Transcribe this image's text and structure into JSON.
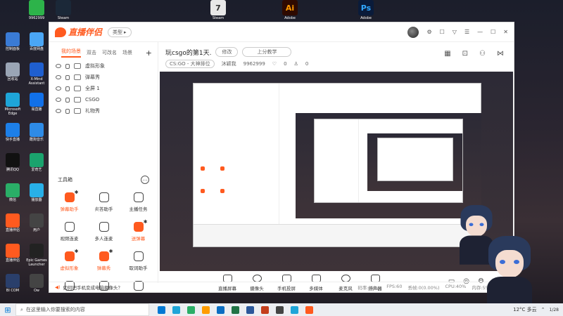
{
  "desktop": {
    "top_icons": [
      {
        "label": "9962999",
        "color": "#2db34a"
      },
      {
        "label": "Steam",
        "color": "#1b2838"
      },
      {
        "label": "Steam",
        "color": "#e8e8e8"
      },
      {
        "label": "Adobe",
        "color": "#2e0a00"
      },
      {
        "label": "Adobe",
        "color": "#0a1b3a"
      }
    ],
    "top_glyphs": [
      "",
      "",
      "7",
      "Ai",
      "Ps"
    ],
    "left_icons": [
      {
        "label": "控制面板",
        "color": "#3a7bd5"
      },
      {
        "label": "百度网盘",
        "color": "#4aa6f5"
      },
      {
        "label": "回收站",
        "color": "#9aa5b5"
      },
      {
        "label": "X-Mind Assistant",
        "color": "#1f5fcf"
      },
      {
        "label": "Microsoft Edge",
        "color": "#1ea5d8"
      },
      {
        "label": "易直播",
        "color": "#1170e8"
      },
      {
        "label": "快手直播",
        "color": "#1d7fe8"
      },
      {
        "label": "酷狗音乐",
        "color": "#2e8be6"
      },
      {
        "label": "腾讯QQ",
        "color": "#111"
      },
      {
        "label": "爱奇艺",
        "color": "#1aa36d"
      },
      {
        "label": "微信",
        "color": "#2aae67"
      },
      {
        "label": "播放器",
        "color": "#28b0e8"
      },
      {
        "label": "直播伴侣",
        "color": "#ff5a1f"
      },
      {
        "label": "用户",
        "color": "#444"
      },
      {
        "label": "直播伴侣",
        "color": "#ff5a1f"
      },
      {
        "label": "Epic Games Launcher",
        "color": "#222"
      },
      {
        "label": "Bl COM",
        "color": "#2a3f6b"
      },
      {
        "label": "Ow",
        "color": "#444"
      }
    ]
  },
  "app": {
    "logo_text": "直播伴侣",
    "type_label": "类型",
    "window_controls": [
      "☐",
      "⚙",
      "▽",
      "☰",
      "—",
      "☐",
      "✕"
    ]
  },
  "sidebar": {
    "tabs": [
      "我的场景",
      "双击",
      "可改名",
      "场景"
    ],
    "add": "+",
    "scenes": [
      "虚拟形象",
      "弹幕秀",
      "全屏 1",
      "CSGO",
      "礼物秀"
    ],
    "tools_title": "工具箱",
    "tools_more": "…",
    "tools": [
      {
        "label": "弹幕助手",
        "orange": true,
        "gear": true
      },
      {
        "label": "炎答助手",
        "orange": false,
        "gear": false
      },
      {
        "label": "主播任务",
        "orange": false,
        "gear": false
      },
      {
        "label": "视频连麦",
        "orange": false,
        "gear": false
      },
      {
        "label": "多人连麦",
        "orange": false,
        "gear": false
      },
      {
        "label": "送弹幕",
        "orange": true,
        "gear": true
      },
      {
        "label": "虚拟形象",
        "orange": true,
        "gear": true
      },
      {
        "label": "弹幕秀",
        "orange": true,
        "gear": true
      },
      {
        "label": "取词助手",
        "orange": false,
        "gear": false
      },
      {
        "label": "",
        "orange": false,
        "gear": false
      },
      {
        "label": "",
        "orange": false,
        "gear": false
      },
      {
        "label": "",
        "orange": false,
        "gear": false
      }
    ]
  },
  "main": {
    "title": "玩csgo的第1天.",
    "edit_label": "修改",
    "tag_label": "上分教学",
    "category": "CS:GO - 大神排位",
    "streamer_id": "沐颖我",
    "room_id": "9962999",
    "counter1_icon": "♡",
    "counter1": "0",
    "counter2_icon": "♙",
    "counter2": "0",
    "header_icons": [
      "▦",
      "⊡",
      "⚇",
      "⋈"
    ]
  },
  "toolbar": {
    "buttons": [
      "直播屏幕",
      "摄像头",
      "手机投屏",
      "多媒体",
      "麦克风",
      "扬声器"
    ],
    "right_icons": [
      "▭",
      "◎",
      "⚙"
    ]
  },
  "status": {
    "tip": "如何把手机变成电脑摄像头？",
    "bitrate": "码率:0kb/s",
    "fps": "FPS:60",
    "drop": "丢帧:0(0.00%)",
    "cpu": "CPU:40%",
    "memory": "内存:55%"
  },
  "taskbar": {
    "start": "⊞",
    "search_placeholder": "在这里输入你要搜索的内容",
    "apps": [
      "#0078d4",
      "#1ea5d8",
      "#2aae67",
      "#ff9c00",
      "#0a6dc2",
      "#217346",
      "#2b579a",
      "#c43e1c",
      "#444",
      "#1ea5d8",
      "#ff5a1f"
    ],
    "weather": "12°C 多云",
    "time": "1/28"
  },
  "colors": {
    "accent": "#ff5a1f"
  }
}
